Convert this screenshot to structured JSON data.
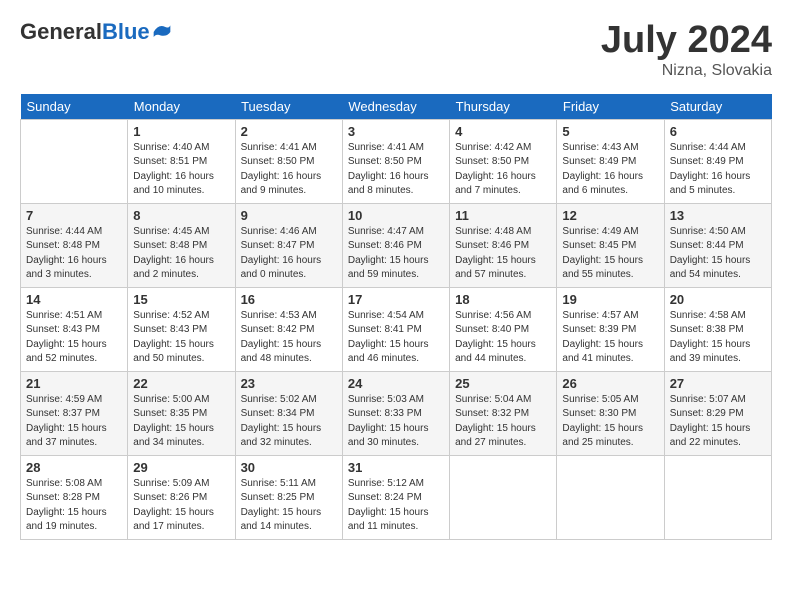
{
  "header": {
    "logo_general": "General",
    "logo_blue": "Blue",
    "month_year": "July 2024",
    "location": "Nizna, Slovakia"
  },
  "columns": [
    "Sunday",
    "Monday",
    "Tuesday",
    "Wednesday",
    "Thursday",
    "Friday",
    "Saturday"
  ],
  "weeks": [
    [
      {
        "day": "",
        "info": ""
      },
      {
        "day": "1",
        "info": "Sunrise: 4:40 AM\nSunset: 8:51 PM\nDaylight: 16 hours\nand 10 minutes."
      },
      {
        "day": "2",
        "info": "Sunrise: 4:41 AM\nSunset: 8:50 PM\nDaylight: 16 hours\nand 9 minutes."
      },
      {
        "day": "3",
        "info": "Sunrise: 4:41 AM\nSunset: 8:50 PM\nDaylight: 16 hours\nand 8 minutes."
      },
      {
        "day": "4",
        "info": "Sunrise: 4:42 AM\nSunset: 8:50 PM\nDaylight: 16 hours\nand 7 minutes."
      },
      {
        "day": "5",
        "info": "Sunrise: 4:43 AM\nSunset: 8:49 PM\nDaylight: 16 hours\nand 6 minutes."
      },
      {
        "day": "6",
        "info": "Sunrise: 4:44 AM\nSunset: 8:49 PM\nDaylight: 16 hours\nand 5 minutes."
      }
    ],
    [
      {
        "day": "7",
        "info": "Sunrise: 4:44 AM\nSunset: 8:48 PM\nDaylight: 16 hours\nand 3 minutes."
      },
      {
        "day": "8",
        "info": "Sunrise: 4:45 AM\nSunset: 8:48 PM\nDaylight: 16 hours\nand 2 minutes."
      },
      {
        "day": "9",
        "info": "Sunrise: 4:46 AM\nSunset: 8:47 PM\nDaylight: 16 hours\nand 0 minutes."
      },
      {
        "day": "10",
        "info": "Sunrise: 4:47 AM\nSunset: 8:46 PM\nDaylight: 15 hours\nand 59 minutes."
      },
      {
        "day": "11",
        "info": "Sunrise: 4:48 AM\nSunset: 8:46 PM\nDaylight: 15 hours\nand 57 minutes."
      },
      {
        "day": "12",
        "info": "Sunrise: 4:49 AM\nSunset: 8:45 PM\nDaylight: 15 hours\nand 55 minutes."
      },
      {
        "day": "13",
        "info": "Sunrise: 4:50 AM\nSunset: 8:44 PM\nDaylight: 15 hours\nand 54 minutes."
      }
    ],
    [
      {
        "day": "14",
        "info": "Sunrise: 4:51 AM\nSunset: 8:43 PM\nDaylight: 15 hours\nand 52 minutes."
      },
      {
        "day": "15",
        "info": "Sunrise: 4:52 AM\nSunset: 8:43 PM\nDaylight: 15 hours\nand 50 minutes."
      },
      {
        "day": "16",
        "info": "Sunrise: 4:53 AM\nSunset: 8:42 PM\nDaylight: 15 hours\nand 48 minutes."
      },
      {
        "day": "17",
        "info": "Sunrise: 4:54 AM\nSunset: 8:41 PM\nDaylight: 15 hours\nand 46 minutes."
      },
      {
        "day": "18",
        "info": "Sunrise: 4:56 AM\nSunset: 8:40 PM\nDaylight: 15 hours\nand 44 minutes."
      },
      {
        "day": "19",
        "info": "Sunrise: 4:57 AM\nSunset: 8:39 PM\nDaylight: 15 hours\nand 41 minutes."
      },
      {
        "day": "20",
        "info": "Sunrise: 4:58 AM\nSunset: 8:38 PM\nDaylight: 15 hours\nand 39 minutes."
      }
    ],
    [
      {
        "day": "21",
        "info": "Sunrise: 4:59 AM\nSunset: 8:37 PM\nDaylight: 15 hours\nand 37 minutes."
      },
      {
        "day": "22",
        "info": "Sunrise: 5:00 AM\nSunset: 8:35 PM\nDaylight: 15 hours\nand 34 minutes."
      },
      {
        "day": "23",
        "info": "Sunrise: 5:02 AM\nSunset: 8:34 PM\nDaylight: 15 hours\nand 32 minutes."
      },
      {
        "day": "24",
        "info": "Sunrise: 5:03 AM\nSunset: 8:33 PM\nDaylight: 15 hours\nand 30 minutes."
      },
      {
        "day": "25",
        "info": "Sunrise: 5:04 AM\nSunset: 8:32 PM\nDaylight: 15 hours\nand 27 minutes."
      },
      {
        "day": "26",
        "info": "Sunrise: 5:05 AM\nSunset: 8:30 PM\nDaylight: 15 hours\nand 25 minutes."
      },
      {
        "day": "27",
        "info": "Sunrise: 5:07 AM\nSunset: 8:29 PM\nDaylight: 15 hours\nand 22 minutes."
      }
    ],
    [
      {
        "day": "28",
        "info": "Sunrise: 5:08 AM\nSunset: 8:28 PM\nDaylight: 15 hours\nand 19 minutes."
      },
      {
        "day": "29",
        "info": "Sunrise: 5:09 AM\nSunset: 8:26 PM\nDaylight: 15 hours\nand 17 minutes."
      },
      {
        "day": "30",
        "info": "Sunrise: 5:11 AM\nSunset: 8:25 PM\nDaylight: 15 hours\nand 14 minutes."
      },
      {
        "day": "31",
        "info": "Sunrise: 5:12 AM\nSunset: 8:24 PM\nDaylight: 15 hours\nand 11 minutes."
      },
      {
        "day": "",
        "info": ""
      },
      {
        "day": "",
        "info": ""
      },
      {
        "day": "",
        "info": ""
      }
    ]
  ]
}
